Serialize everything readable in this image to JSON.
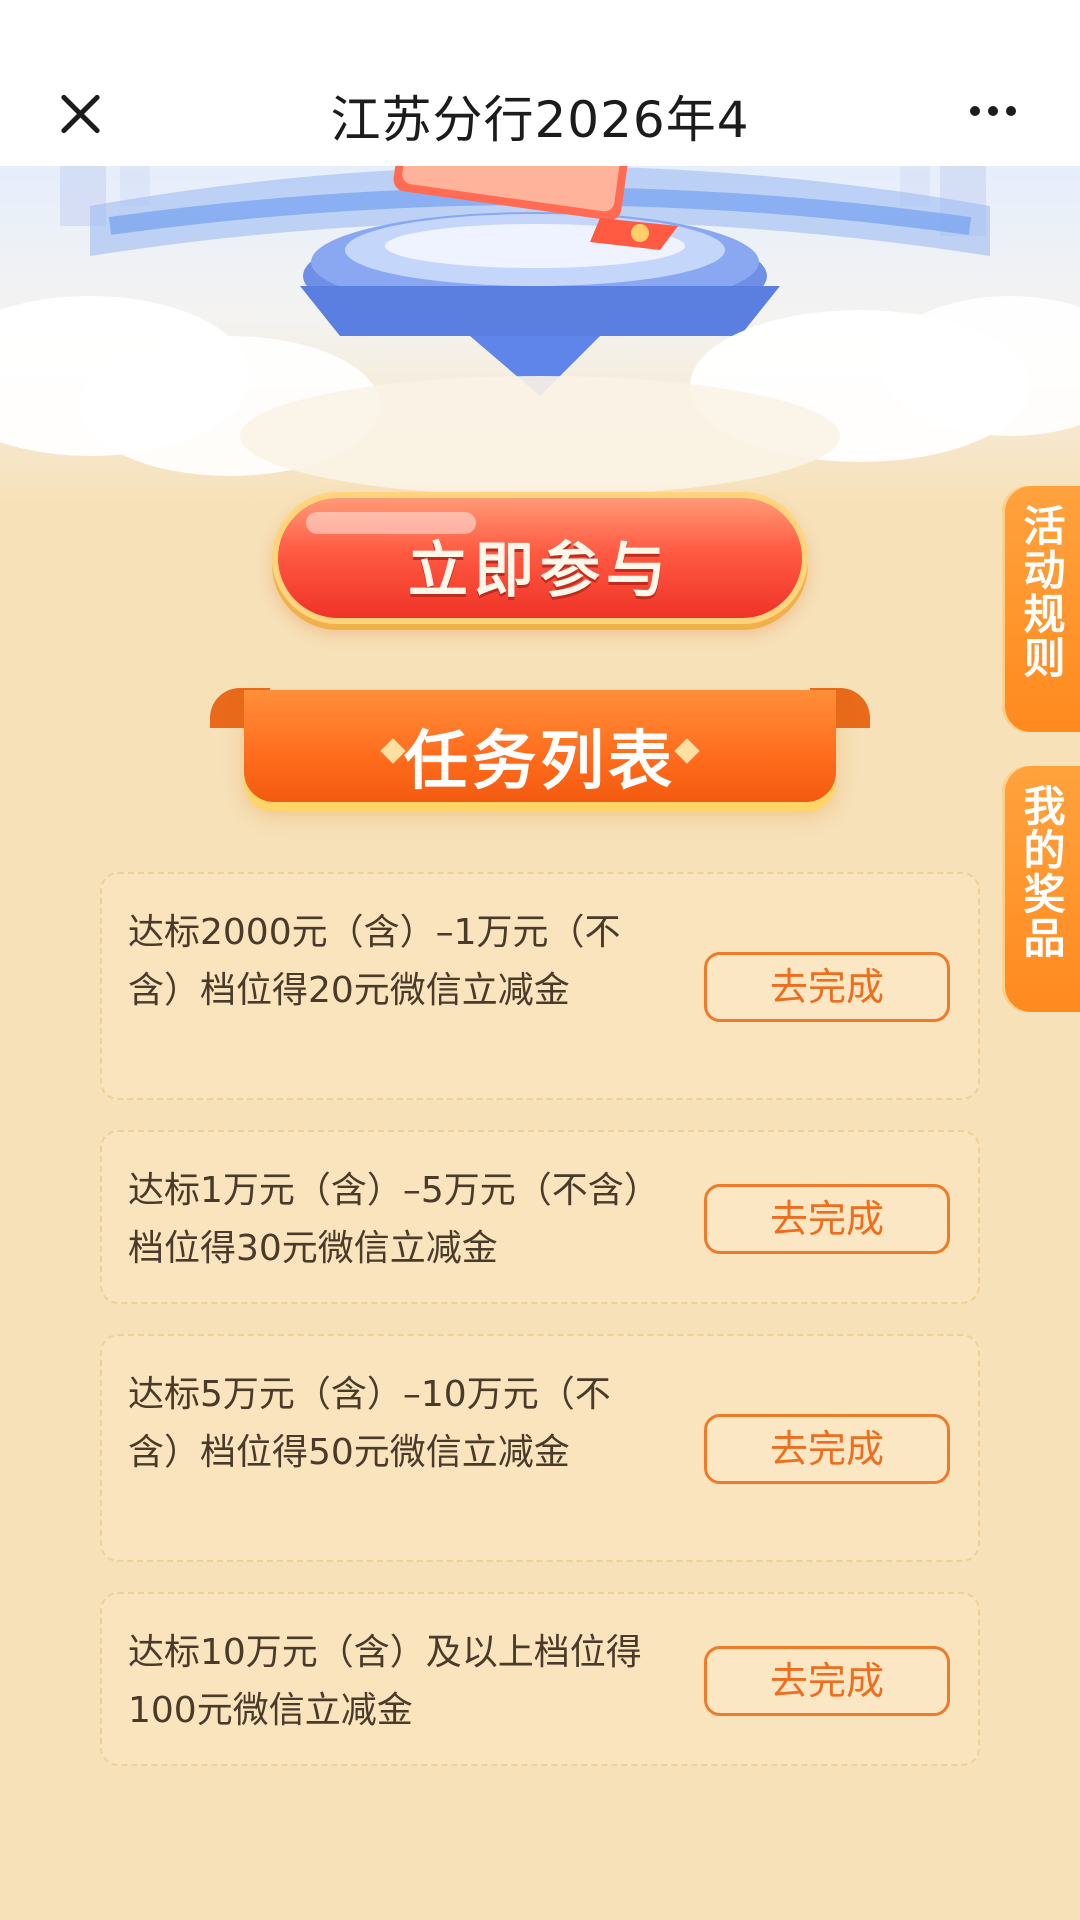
{
  "topbar": {
    "title": "江苏分行2026年4",
    "close_icon": "close-icon",
    "more_icon": "more-icon"
  },
  "hero": {
    "decor": "stage-illustration"
  },
  "join_button": {
    "label": "立即参与"
  },
  "task_list": {
    "title": "任务列表",
    "tasks": [
      {
        "text": "达标2000元（含）–1万元（不含）档位得20元微信立减金",
        "action": "去完成"
      },
      {
        "text": "达标1万元（含）–5万元（不含）档位得30元微信立减金",
        "action": "去完成"
      },
      {
        "text": "达标5万元（含）–10万元（不含）档位得50元微信立减金",
        "action": "去完成"
      },
      {
        "text": "达标10万元（含）及以上档位得100元微信立减金",
        "action": "去完成"
      }
    ]
  },
  "side_tabs": {
    "rules": "活动规则",
    "prizes": "我的奖品"
  },
  "colors": {
    "background": "#f7e1b8",
    "primary_orange": "#ff6c1c",
    "button_red": "#ef3328",
    "button_text": "#ef6d1e",
    "text_dark": "#4a3a2a"
  }
}
